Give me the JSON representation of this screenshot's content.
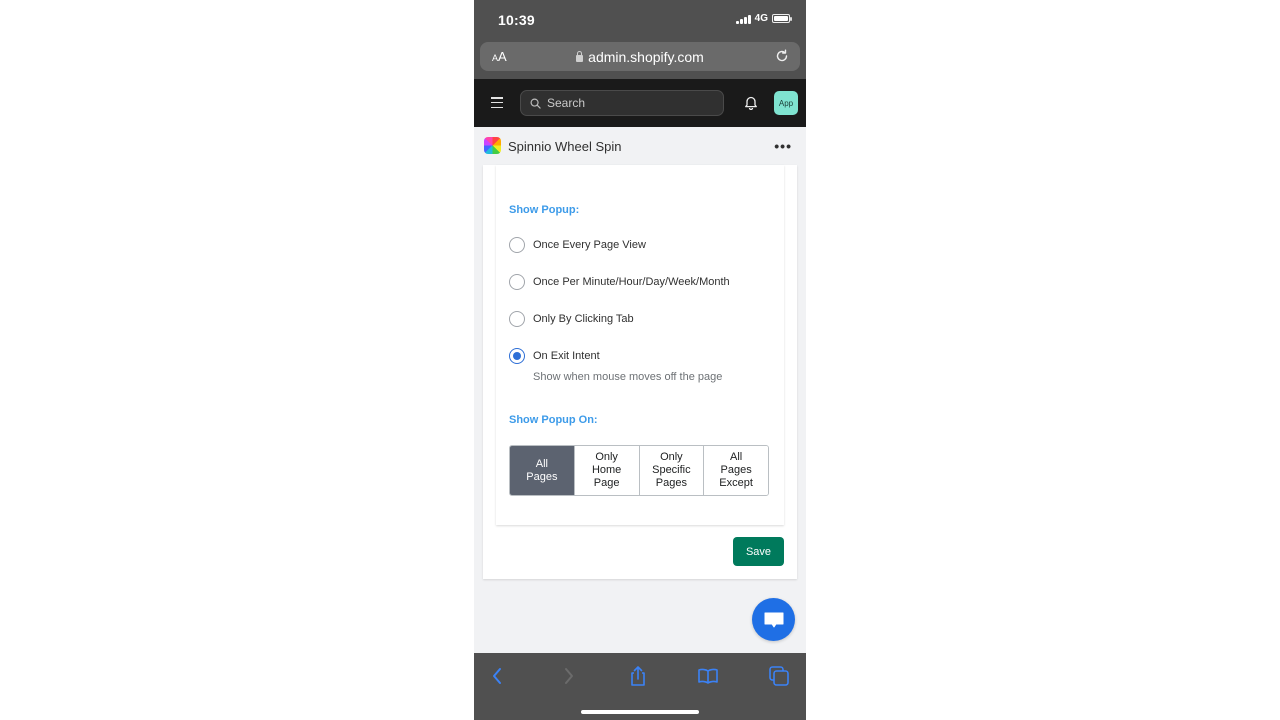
{
  "status_bar": {
    "time": "10:39",
    "network": "4G",
    "signal_bars": 4,
    "battery_level": 1.0
  },
  "browser": {
    "text_size_label_small": "A",
    "text_size_label_large": "A",
    "url": "admin.shopify.com",
    "icons": [
      "lock-icon",
      "reload-icon"
    ],
    "toolbar_icons": [
      "back-icon",
      "forward-icon",
      "share-icon",
      "bookmarks-icon",
      "tabs-icon"
    ]
  },
  "shopify_nav": {
    "search_placeholder": "Search",
    "app_badge": "App",
    "icons": [
      "menu-icon",
      "search-icon",
      "bell-icon"
    ]
  },
  "app_header": {
    "title": "Spinnio Wheel Spin",
    "more_label": "•••"
  },
  "settings": {
    "show_popup": {
      "heading": "Show Popup:",
      "options": [
        {
          "label": "Once Every Page View",
          "checked": false
        },
        {
          "label": "Once Per Minute/Hour/Day/Week/Month",
          "checked": false
        },
        {
          "label": "Only By Clicking Tab",
          "checked": false
        },
        {
          "label": "On Exit Intent",
          "checked": true,
          "help": "Show when mouse moves off the page"
        }
      ]
    },
    "show_popup_on": {
      "heading": "Show Popup On:",
      "segments": [
        {
          "label": "All\nPages",
          "active": true
        },
        {
          "label": "Only\nHome\nPage",
          "active": false
        },
        {
          "label": "Only\nSpecific\nPages",
          "active": false
        },
        {
          "label": "All\nPages\nExcept",
          "active": false
        }
      ]
    },
    "save_label": "Save"
  },
  "colors": {
    "accent_heading": "#3d9be9",
    "radio_checked": "#2e6fd6",
    "segment_active": "#5c6370",
    "save_button": "#007a5c",
    "chat_fab": "#1f6fe5",
    "toolbar_icon": "#3b82f6"
  }
}
